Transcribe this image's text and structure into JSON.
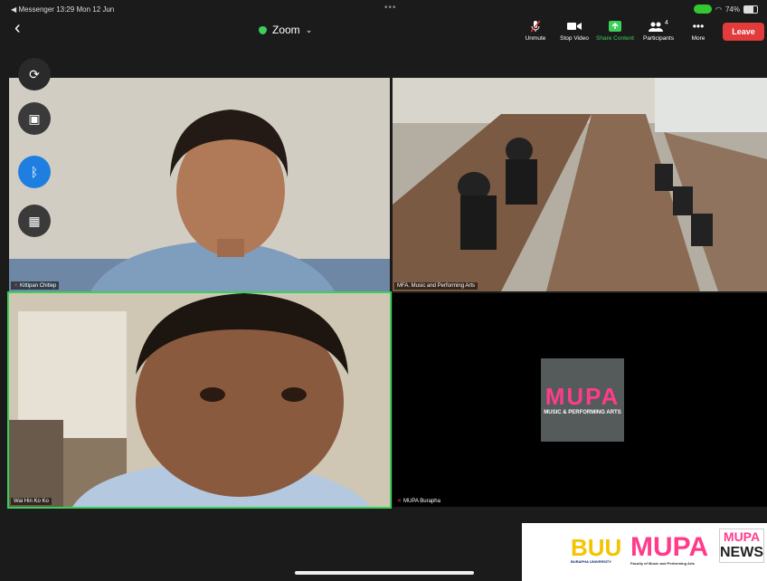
{
  "status": {
    "app": "◀ Messenger",
    "time": "13:29",
    "date": "Mon 12 Jun",
    "battery": "74%"
  },
  "meeting": {
    "title": "Zoom"
  },
  "toolbar": [
    {
      "label": "Unmute",
      "icon": "mic-off-icon"
    },
    {
      "label": "Stop Video",
      "icon": "video-icon"
    },
    {
      "label": "Share Content",
      "icon": "share-icon"
    },
    {
      "label": "Participants",
      "icon": "participants-icon",
      "count": "4"
    },
    {
      "label": "More",
      "icon": "more-icon"
    }
  ],
  "leave_label": "Leave",
  "side_controls": [
    {
      "label": "Switch Camera",
      "icon": "camera-switch-icon"
    },
    {
      "label": "Turn Off Center Stage",
      "icon": "center-stage-icon"
    },
    {
      "label": "Bluetooth",
      "icon": "bluetooth-icon"
    },
    {
      "label": "Switch to Active Speaker",
      "icon": "active-speaker-icon"
    }
  ],
  "participants": [
    {
      "name": "Kittipan Chitlep",
      "muted": true
    },
    {
      "name": "MFA. Music and Performing Arts",
      "muted": false
    },
    {
      "name": "Wai Hin Ko Ko",
      "muted": false
    },
    {
      "name": "MUPA Burapha",
      "muted": true
    }
  ],
  "mupa_tile": {
    "logo_text": "MUPA",
    "logo_sub": "MUSIC & PERFORMING ARTS"
  },
  "banner": {
    "buu": "BUU",
    "buu_sub": "BURAPHA UNIVERSITY",
    "mupa": "MUPA",
    "mupa_sub": "Faculty of Music and Performing Arts",
    "news_top": "MUPA",
    "news": "NEWS"
  },
  "colors": {
    "accent_green": "#3ccf5a",
    "leave_red": "#e23b3b",
    "mupa_pink": "#ff3c8c",
    "buu_yellow": "#f5c400"
  }
}
